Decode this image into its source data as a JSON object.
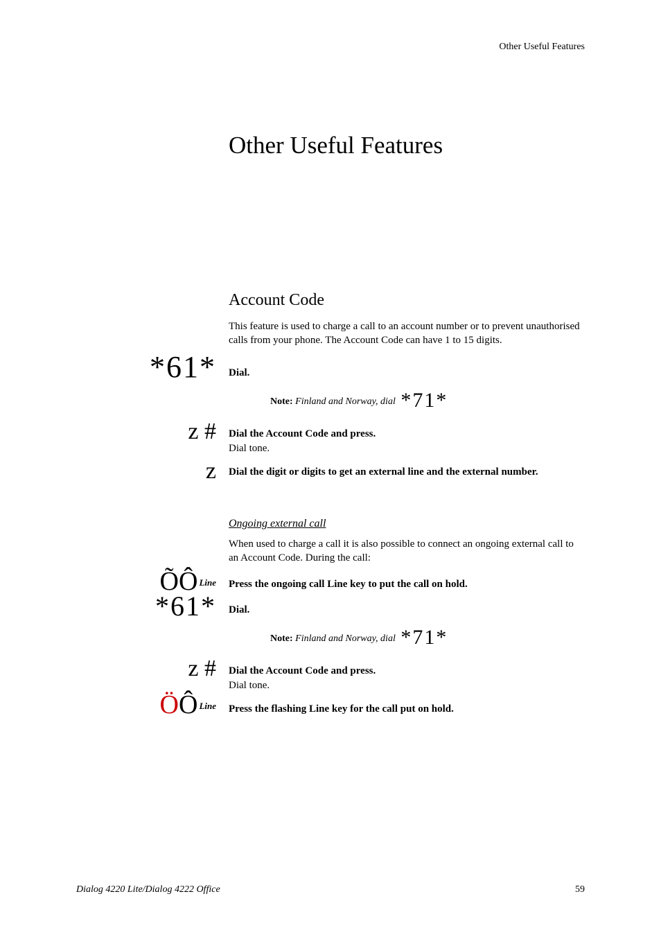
{
  "header": {
    "right": "Other Useful Features"
  },
  "title": "Other Useful Features",
  "section": {
    "heading": "Account Code",
    "intro": "This feature is used to charge a call to an account number or to prevent unauthorised calls from your phone. The Account Code can have 1 to 15 digits.",
    "steps": [
      {
        "left": "*61*",
        "bold": "Dial.",
        "rest": "",
        "note_label": "Note:",
        "note_text": " Finland and Norway, dial",
        "note_code": "*71*"
      },
      {
        "left": "z #",
        "bold": "Dial the Account Code and press.",
        "rest": "Dial tone."
      },
      {
        "left": "z",
        "bold": "Dial the digit or digits to get an external line and the external number.",
        "rest": ""
      }
    ],
    "sub": {
      "heading": "Ongoing external call",
      "intro": "When used to charge a call it is also possible to connect an ongoing external call to an Account Code. During the call:",
      "steps": [
        {
          "left_keys": "ÕÔ",
          "left_label": "Line",
          "left2": "*61*",
          "bold": "Press the ongoing call Line key to put the call on hold.",
          "bold2": "Dial.",
          "note_label": "Note:",
          "note_text": " Finland and Norway, dial",
          "note_code": "*71*"
        },
        {
          "left": "z #",
          "bold": "Dial the Account Code and press.",
          "rest": "Dial tone."
        },
        {
          "left_keys": "ÖÔ",
          "left_label": "Line",
          "bold": "Press the flashing Line key for the call put on hold."
        }
      ]
    }
  },
  "footer": {
    "left": "Dialog 4220 Lite/Dialog 4222 Office",
    "right": "59"
  }
}
